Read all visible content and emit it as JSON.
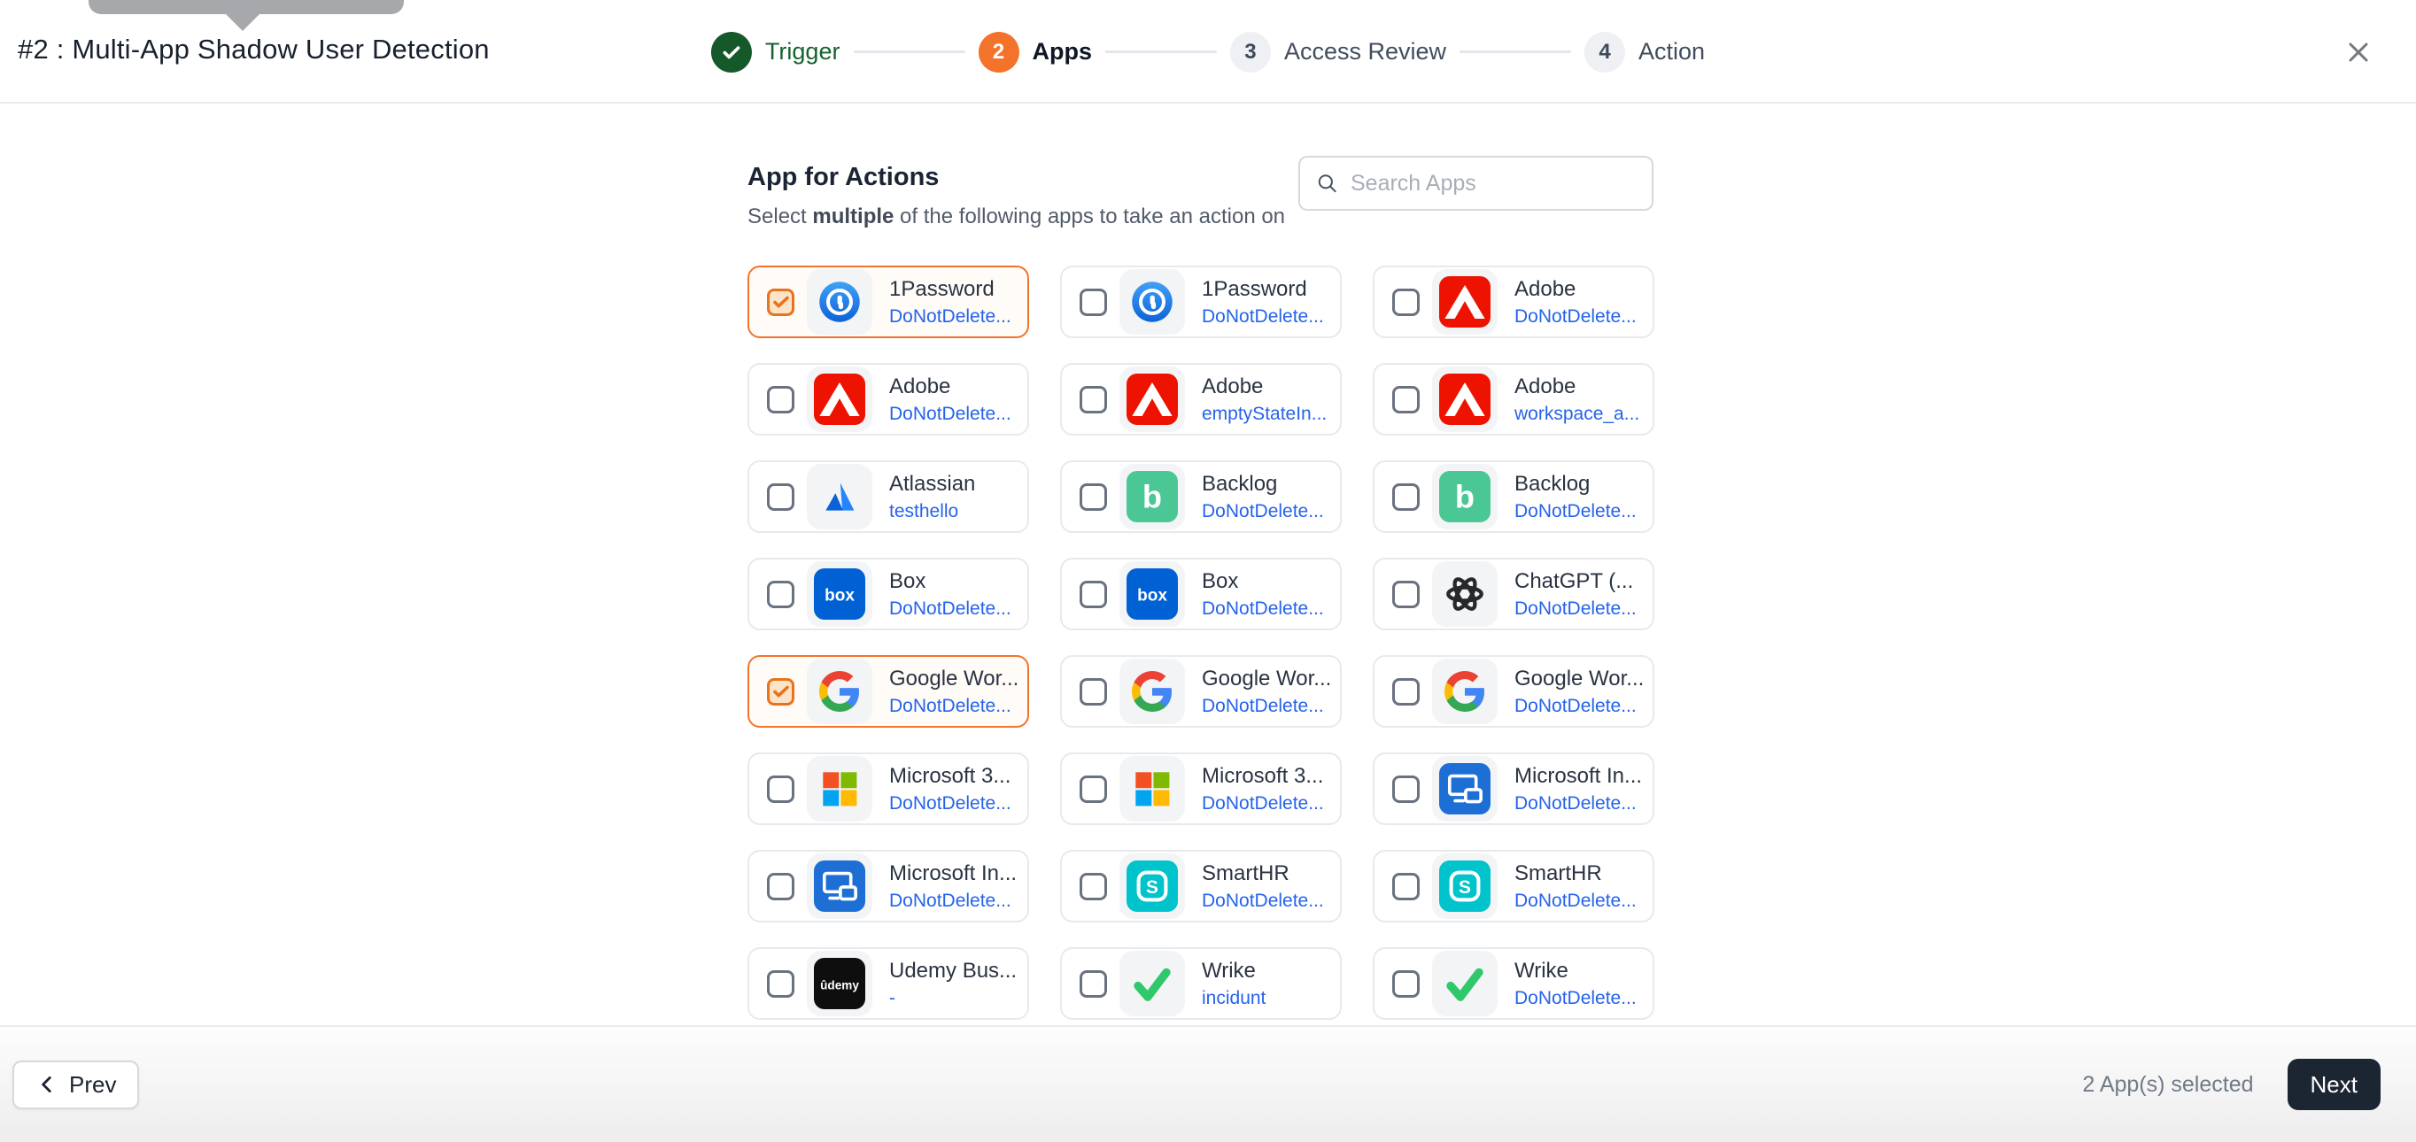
{
  "header": {
    "title": "#2 : Multi-App Shadow User Detection",
    "steps": [
      {
        "label": "Trigger",
        "state": "complete",
        "number": ""
      },
      {
        "label": "Apps",
        "state": "active",
        "number": "2"
      },
      {
        "label": "Access Review",
        "state": "upcoming",
        "number": "3"
      },
      {
        "label": "Action",
        "state": "upcoming",
        "number": "4"
      }
    ]
  },
  "main": {
    "heading": "App for Actions",
    "subtitle_prefix": "Select ",
    "subtitle_bold": "multiple",
    "subtitle_suffix": " of the following apps to take an action on",
    "search": {
      "placeholder": "Search Apps"
    }
  },
  "apps": [
    {
      "name": "1Password",
      "sublabel": "DoNotDelete...",
      "icon": "onepassword",
      "selected": true
    },
    {
      "name": "1Password",
      "sublabel": "DoNotDelete...",
      "icon": "onepassword",
      "selected": false
    },
    {
      "name": "Adobe",
      "sublabel": "DoNotDelete...",
      "icon": "adobe",
      "selected": false
    },
    {
      "name": "Adobe",
      "sublabel": "DoNotDelete...",
      "icon": "adobe",
      "selected": false
    },
    {
      "name": "Adobe",
      "sublabel": "emptyStateIn...",
      "icon": "adobe",
      "selected": false
    },
    {
      "name": "Adobe",
      "sublabel": "workspace_a...",
      "icon": "adobe",
      "selected": false
    },
    {
      "name": "Atlassian",
      "sublabel": "testhello",
      "icon": "atlassian",
      "selected": false
    },
    {
      "name": "Backlog",
      "sublabel": "DoNotDelete...",
      "icon": "backlog",
      "selected": false
    },
    {
      "name": "Backlog",
      "sublabel": "DoNotDelete...",
      "icon": "backlog",
      "selected": false
    },
    {
      "name": "Box",
      "sublabel": "DoNotDelete...",
      "icon": "box",
      "selected": false
    },
    {
      "name": "Box",
      "sublabel": "DoNotDelete...",
      "icon": "box",
      "selected": false
    },
    {
      "name": "ChatGPT (...",
      "sublabel": "DoNotDelete...",
      "icon": "chatgpt",
      "selected": false
    },
    {
      "name": "Google Wor...",
      "sublabel": "DoNotDelete...",
      "icon": "google",
      "selected": true
    },
    {
      "name": "Google Wor...",
      "sublabel": "DoNotDelete...",
      "icon": "google",
      "selected": false
    },
    {
      "name": "Google Wor...",
      "sublabel": "DoNotDelete...",
      "icon": "google",
      "selected": false
    },
    {
      "name": "Microsoft 3...",
      "sublabel": "DoNotDelete...",
      "icon": "microsoft365",
      "selected": false
    },
    {
      "name": "Microsoft 3...",
      "sublabel": "DoNotDelete...",
      "icon": "microsoft365",
      "selected": false
    },
    {
      "name": "Microsoft In...",
      "sublabel": "DoNotDelete...",
      "icon": "intune",
      "selected": false
    },
    {
      "name": "Microsoft In...",
      "sublabel": "DoNotDelete...",
      "icon": "intune",
      "selected": false
    },
    {
      "name": "SmartHR",
      "sublabel": "DoNotDelete...",
      "icon": "smarthr",
      "selected": false
    },
    {
      "name": "SmartHR",
      "sublabel": "DoNotDelete...",
      "icon": "smarthr",
      "selected": false
    },
    {
      "name": "Udemy Bus...",
      "sublabel": "-",
      "icon": "udemy",
      "selected": false
    },
    {
      "name": "Wrike",
      "sublabel": "incidunt",
      "icon": "wrike",
      "selected": false
    },
    {
      "name": "Wrike",
      "sublabel": "DoNotDelete...",
      "icon": "wrike",
      "selected": false
    }
  ],
  "footer": {
    "prev_label": "Prev",
    "selected_count_text": "2 App(s) selected",
    "next_label": "Next"
  },
  "colors": {
    "accent_orange": "#f4732a",
    "success_green": "#15582a",
    "link_blue": "#2563eb",
    "next_button_bg": "#1c2633",
    "card_border": "#e7e9ed"
  }
}
